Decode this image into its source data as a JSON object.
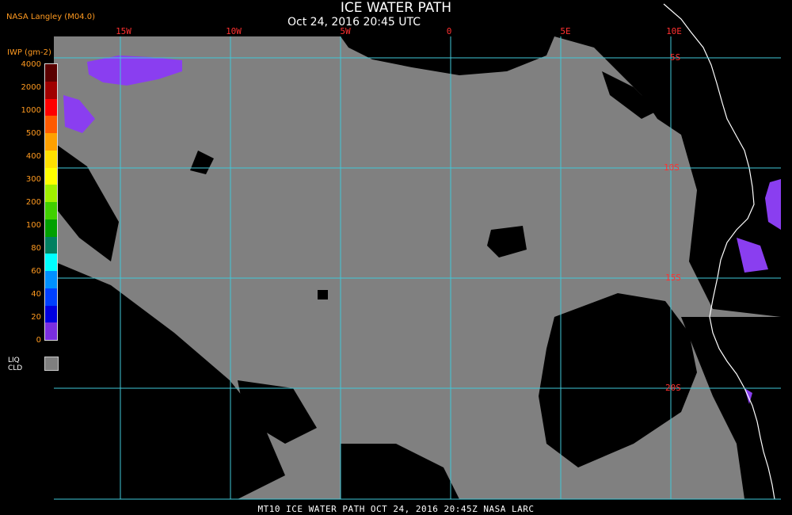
{
  "header": {
    "title": "ICE WATER PATH",
    "subtitle": "Oct 24, 2016 20:45 UTC",
    "source": "NASA Langley (M04.0)"
  },
  "grid": {
    "longitudes": [
      "15W",
      "10W",
      "5W",
      "0",
      "5E",
      "10E"
    ],
    "latitudes": [
      "5S",
      "10S",
      "15S",
      "20S"
    ]
  },
  "legend": {
    "title": "IWP (gm-2)",
    "levels": [
      "4000",
      "2000",
      "1000",
      "500",
      "400",
      "300",
      "200",
      "100",
      "80",
      "60",
      "40",
      "20",
      "0"
    ],
    "colors": [
      "#5a0000",
      "#a00000",
      "#ff0000",
      "#ff5a00",
      "#ffa000",
      "#ffe000",
      "#ffff00",
      "#a0f000",
      "#40d000",
      "#00a000",
      "#008060",
      "#00ffff",
      "#0090ff",
      "#0040ff",
      "#0000e0",
      "#7a2ee0"
    ],
    "liquid_label_1": "LIQ",
    "liquid_label_2": "CLD",
    "liquid_color": "#7f7f7f"
  },
  "colors": {
    "liquid_cloud": "#808080",
    "clear": "#000000",
    "gridline": "#40c8d8",
    "coastline": "#ffffff",
    "thin_ice": "#8a3ef0"
  },
  "footer": "MT10  ICE WATER PATH   OCT 24, 2016 20:45Z   NASA LARC"
}
